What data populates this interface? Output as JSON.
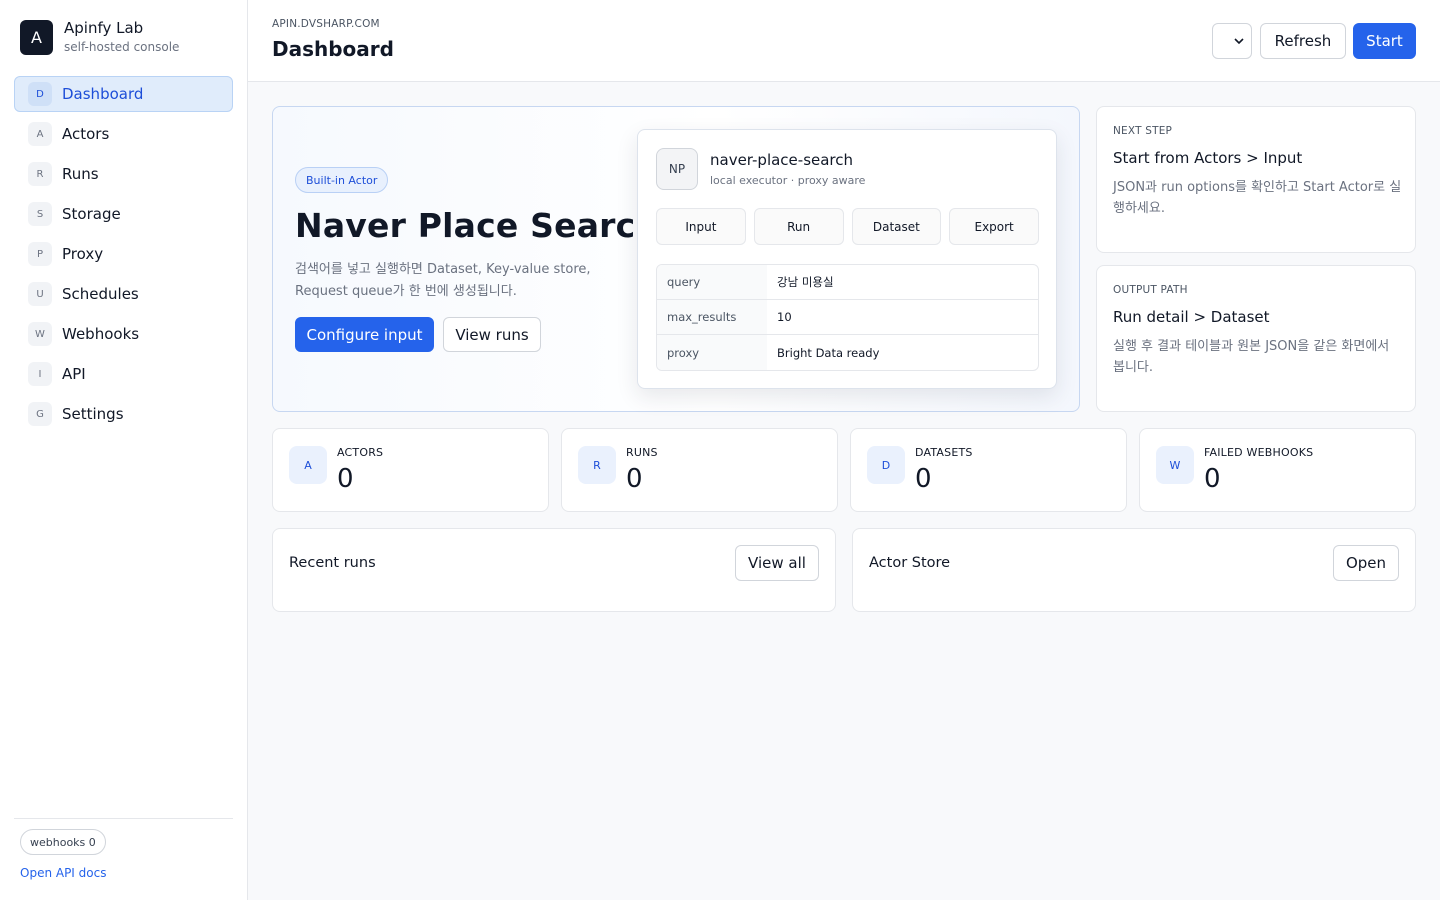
{
  "brand": {
    "logo": "A",
    "name": "Apinfy Lab",
    "subtitle": "self-hosted console"
  },
  "sidebar": {
    "items": [
      {
        "icon": "D",
        "label": "Dashboard",
        "active": true
      },
      {
        "icon": "A",
        "label": "Actors"
      },
      {
        "icon": "R",
        "label": "Runs"
      },
      {
        "icon": "S",
        "label": "Storage"
      },
      {
        "icon": "P",
        "label": "Proxy"
      },
      {
        "icon": "U",
        "label": "Schedules"
      },
      {
        "icon": "W",
        "label": "Webhooks"
      },
      {
        "icon": "I",
        "label": "API"
      },
      {
        "icon": "G",
        "label": "Settings"
      }
    ],
    "footer": {
      "webhooks_pill": "webhooks 0",
      "api_docs_link": "Open API docs"
    }
  },
  "header": {
    "domain": "APIN.DVSHARP.COM",
    "title": "Dashboard",
    "select_chevron": "⌄",
    "refresh_label": "Refresh",
    "start_label": "Start"
  },
  "hero": {
    "badge": "Built-in Actor",
    "title": "Naver Place Search",
    "description": "검색어를 넣고 실행하면 Dataset, Key-value store, Request queue가 한 번에 생성됩니다.",
    "configure_label": "Configure input",
    "view_runs_label": "View runs",
    "actor_card": {
      "avatar": "NP",
      "name": "naver-place-search",
      "subtitle": "local executor · proxy aware",
      "tabs": [
        "Input",
        "Run",
        "Dataset",
        "Export"
      ],
      "rows": [
        {
          "key": "query",
          "value": "강남 미용실"
        },
        {
          "key": "max_results",
          "value": "10"
        },
        {
          "key": "proxy",
          "value": "Bright Data ready"
        }
      ]
    }
  },
  "next_step": {
    "kicker": "NEXT STEP",
    "title": "Start from Actors > Input",
    "description": "JSON과 run options를 확인하고 Start Actor로 실행하세요."
  },
  "output_path": {
    "kicker": "OUTPUT PATH",
    "title": "Run detail > Dataset",
    "description": "실행 후 결과 테이블과 원본 JSON을 같은 화면에서 봅니다."
  },
  "stats": [
    {
      "icon": "A",
      "label": "ACTORS",
      "value": "0"
    },
    {
      "icon": "R",
      "label": "RUNS",
      "value": "0"
    },
    {
      "icon": "D",
      "label": "DATASETS",
      "value": "0"
    },
    {
      "icon": "W",
      "label": "FAILED WEBHOOKS",
      "value": "0"
    }
  ],
  "recent_runs": {
    "title": "Recent runs",
    "button": "View all"
  },
  "actor_store": {
    "title": "Actor Store",
    "button": "Open"
  },
  "colors": {
    "accent": "#2563eb",
    "sidebar_active_bg": "#e0ecfb",
    "text": "#111827",
    "muted": "#6b7280"
  }
}
